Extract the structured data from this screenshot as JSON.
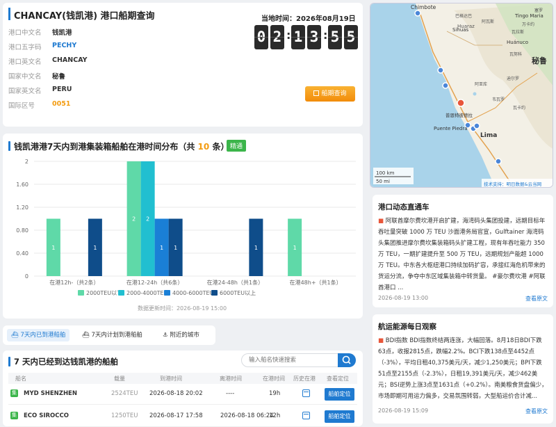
{
  "port": {
    "title": "CHANCAY(钱凯港) 港口船期查询",
    "rows": [
      {
        "label": "港口中文名",
        "value": "钱凯港"
      },
      {
        "label": "港口五字码",
        "value": "PECHY"
      },
      {
        "label": "港口英文名",
        "value": "CHANCAY"
      },
      {
        "label": "国家中文名",
        "value": "秘鲁"
      },
      {
        "label": "国家英文名",
        "value": "PERU"
      },
      {
        "label": "国际区号",
        "value": "0051"
      }
    ],
    "time_label": "当地时间：2026年08月19日",
    "clock": [
      "0",
      "2",
      "1",
      "3",
      "5",
      "5"
    ],
    "query_button": "船期查询"
  },
  "map": {
    "labels": {
      "chimbote": "Chimbote",
      "sihuas": "Sihuas",
      "tingo": "Tingo Maria",
      "huaraz": "Huaraz",
      "huanuco": "Huánuco",
      "peru": "秘鲁",
      "lima": "Lima",
      "puente": "Puente Piedra",
      "chancay_cn": "普恩特彼德拉",
      "scale_km": "100 km",
      "scale_mi": "50 mi",
      "attribution": "技术支持：明日数据&云当网",
      "cn1": "巴格达巴",
      "cn2": "阿瓦斯",
      "cn3": "瓦拉斯",
      "cn4": "韦瓦罗",
      "cn5": "瓦卡约",
      "cn6": "阿亚库",
      "cn7": "迪尔罗",
      "cn8": "塞罗",
      "cn9": "万卡约",
      "cn10": "瓦努科"
    }
  },
  "chart": {
    "title_prefix": "钱凯港港7天内到港集装箱船舶在港时间分布（共",
    "count": "10",
    "title_suffix": "条）",
    "tag": "精通",
    "update": "数据更新时间：2026-08-19 15:00"
  },
  "chart_data": {
    "type": "bar",
    "categories": [
      "在港12h-（共2条）",
      "在港12-24h（共6条）",
      "在港24-48h（共1条）",
      "在港48h+（共1条）"
    ],
    "series": [
      {
        "name": "2000TEU以下",
        "color": "#5fd9a8",
        "values": [
          1,
          2,
          0,
          1
        ]
      },
      {
        "name": "2000-4000TEU",
        "color": "#21bfd0",
        "values": [
          0,
          2,
          0,
          0
        ]
      },
      {
        "name": "4000-6000TEU",
        "color": "#1a7fd6",
        "values": [
          0,
          1,
          0,
          0
        ]
      },
      {
        "name": "6000TEU以上",
        "color": "#0f4d8a",
        "values": [
          1,
          1,
          1,
          0
        ]
      }
    ],
    "ylim": [
      0,
      2
    ],
    "yticks": [
      "0",
      "0.40",
      "0.80",
      "1.20",
      "1.60",
      "2"
    ]
  },
  "tabs": [
    {
      "label": "7天内已到港船舶",
      "active": true
    },
    {
      "label": "7天内计划到港船舶",
      "active": false
    },
    {
      "label": "附近的城市",
      "active": false
    }
  ],
  "list": {
    "title": "7 天内已经到达钱凯港的船舶",
    "search_placeholder": "输入船名快速搜索",
    "headers": [
      "船名",
      "载量",
      "到港时间",
      "离港时间",
      "在港时间",
      "历史在港",
      "查看定位"
    ],
    "rows": [
      {
        "name": "MYD SHENZHEN",
        "capacity": "2524TEU",
        "arrive": "2026-08-18 20:02",
        "depart": "----",
        "stay": "19h",
        "btn": "船舶定位"
      },
      {
        "name": "ECO SIROCCO",
        "capacity": "1250TEU",
        "arrive": "2026-08-17 17:58",
        "depart": "2026-08-18 06:24",
        "stay": "12h",
        "btn": "船舶定位"
      }
    ]
  },
  "news": [
    {
      "title": "港口动态直通车",
      "body": "阿联酋摩尔费坎港开启扩建，海湾码头集团投建，远期目标年吞吐量突破 1000 万 TEU 沙面港务局官宣，Gulftainer 海湾码头集团推进摩尔费坎集装箱码头扩建工程，现有年吞吐能力 350 万 TEU，一期扩建提升至 500 万 TEU，远期规划产能超 1000 万 TEU。中东各大枢纽港口持续加码扩容，承接红海危机带来的货运分流，争夺中东区域集装箱中转货量。 #豪尔费坎港 #阿联酋港口 ...",
      "date": "2026-08-19 13:00",
      "link": "查看原文"
    },
    {
      "title": "航运能源每日观察",
      "body": "BDI指数 BDI指数终结两连涨，大幅回落。8月18日BDI下跌63点，收报2815点，跌幅2.2%。BCI下跌138点至4452点（-3%），平均日租40,375美元/天，减少1,250美元；BPI下跌51点至2155点（-2.3%），日租19,391美元/天，减少462美元；BSI逆势上涨3点至1631点（+0.2%）。南美粮食货盘偏少，市场即期可用运力偏多，交易氛围转弱，大型船运价合计减...",
      "date": "2026-08-19 15:09",
      "link": "查看原文"
    }
  ]
}
